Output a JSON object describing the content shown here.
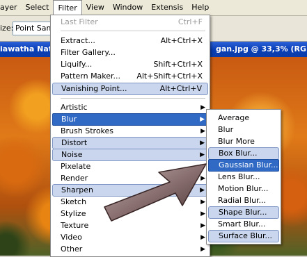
{
  "menubar": {
    "items": [
      "ayer",
      "Select",
      "Filter",
      "View",
      "Window",
      "Extensis",
      "Help"
    ]
  },
  "options": {
    "size_label": "ize:",
    "sample_value": "Point Samp"
  },
  "document": {
    "title_left": "iawatha Nat",
    "title_right": "gan.jpg @ 33,3% (RGB/"
  },
  "filter_menu": {
    "last_filter": {
      "label": "Last Filter",
      "shortcut": "Ctrl+F"
    },
    "extract": {
      "label": "Extract...",
      "shortcut": "Alt+Ctrl+X"
    },
    "gallery": {
      "label": "Filter Gallery..."
    },
    "liquify": {
      "label": "Liquify...",
      "shortcut": "Shift+Ctrl+X"
    },
    "pattern": {
      "label": "Pattern Maker...",
      "shortcut": "Alt+Shift+Ctrl+X"
    },
    "vanishing": {
      "label": "Vanishing Point...",
      "shortcut": "Alt+Ctrl+V"
    },
    "submenus": [
      "Artistic",
      "Blur",
      "Brush Strokes",
      "Distort",
      "Noise",
      "Pixelate",
      "Render",
      "Sharpen",
      "Sketch",
      "Stylize",
      "Texture",
      "Video",
      "Other"
    ]
  },
  "blur_menu": {
    "items": [
      "Average",
      "Blur",
      "Blur More",
      "Box Blur...",
      "Gaussian Blur...",
      "Lens Blur...",
      "Motion Blur...",
      "Radial Blur...",
      "Shape Blur...",
      "Smart Blur...",
      "Surface Blur..."
    ]
  },
  "colors": {
    "selected": "#316ac5",
    "highlight": "#c9d6ee",
    "titlebar": "#0a3fb8"
  },
  "icons": [
    "submenu-arrow-icon",
    "pointer-arrow-icon"
  ]
}
